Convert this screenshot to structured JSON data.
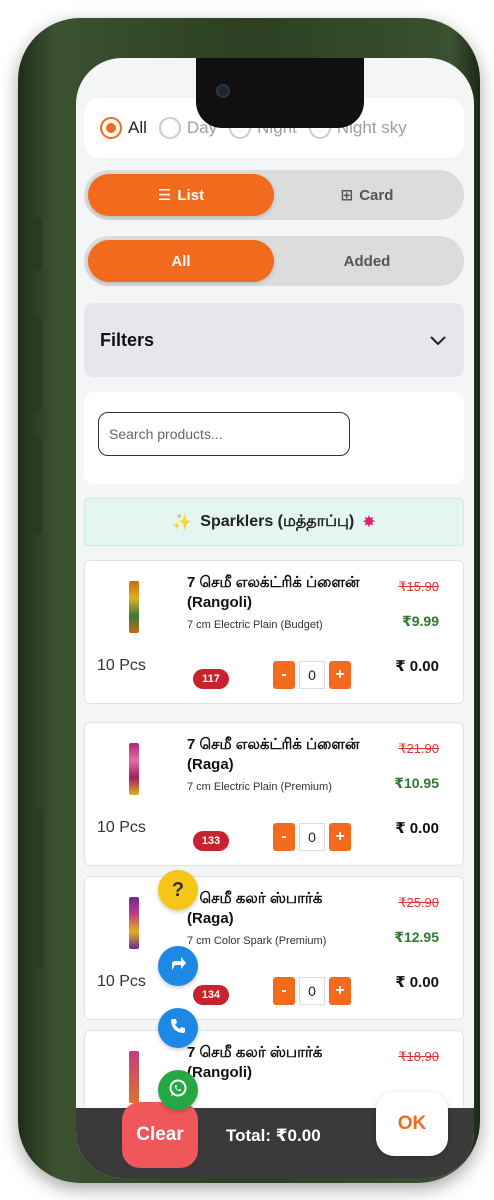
{
  "time_filter": {
    "options": [
      {
        "label": "All",
        "selected": true
      },
      {
        "label": "Day",
        "selected": false
      },
      {
        "label": "Night",
        "selected": false
      },
      {
        "label": "Night sky",
        "selected": false
      }
    ]
  },
  "view_toggle": {
    "list_label": "List",
    "card_label": "Card",
    "active": "List"
  },
  "added_toggle": {
    "all_label": "All",
    "added_label": "Added",
    "active": "All"
  },
  "filters": {
    "label": "Filters"
  },
  "search": {
    "placeholder": "Search products..."
  },
  "category": {
    "title": "Sparklers (மத்தாப்பு)"
  },
  "products": [
    {
      "name": "7 செமீ எலக்ட்ரிக் ப்ளைன் (Rangoli)",
      "subtitle": "7 cm Electric Plain (Budget)",
      "old_price": "₹15.90",
      "price": "₹9.99",
      "pack": "10 Pcs",
      "code": "117",
      "qty": "0",
      "total": "₹ 0.00"
    },
    {
      "name": "7 செமீ எலக்ட்ரிக் ப்ளைன் (Raga)",
      "subtitle": "7 cm Electric Plain (Premium)",
      "old_price": "₹21.90",
      "price": "₹10.95",
      "pack": "10 Pcs",
      "code": "133",
      "qty": "0",
      "total": "₹ 0.00"
    },
    {
      "name": "7 செமீ கலர் ஸ்பார்க் (Raga)",
      "subtitle": "7 cm Color Spark (Premium)",
      "old_price": "₹25.90",
      "price": "₹12.95",
      "pack": "10 Pcs",
      "code": "134",
      "qty": "0",
      "total": "₹ 0.00"
    },
    {
      "name": "7 செமீ கலர் ஸ்பார்க் (Rangoli)",
      "old_price": "₹18.90"
    }
  ],
  "stepper": {
    "minus": "-",
    "plus": "+"
  },
  "fabs": {
    "help": "?"
  },
  "bottom_bar": {
    "clear_label": "Clear",
    "total_label": "Total: ₹0.00",
    "ok_label": "OK"
  },
  "colors": {
    "accent": "#f26a1b",
    "badge": "#c8222c",
    "price_green": "#2c7a2c",
    "strike_red": "#d33333",
    "bar": "#3a3a3a",
    "clear": "#f0575a"
  }
}
